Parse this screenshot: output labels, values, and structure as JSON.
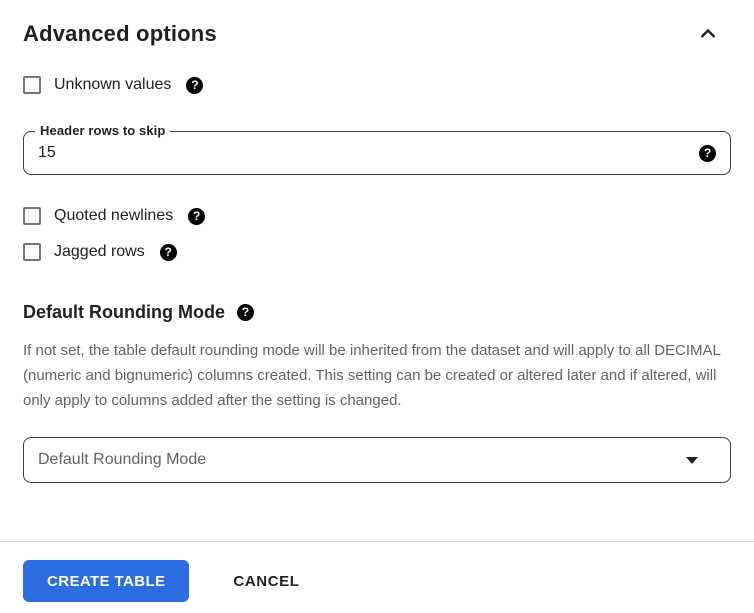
{
  "panel": {
    "title": "Advanced options"
  },
  "fields": {
    "unknown_values": {
      "label": "Unknown values",
      "checked": false
    },
    "header_rows_to_skip": {
      "label": "Header rows to skip",
      "value": "15"
    },
    "quoted_newlines": {
      "label": "Quoted newlines",
      "checked": false
    },
    "jagged_rows": {
      "label": "Jagged rows",
      "checked": false
    }
  },
  "rounding": {
    "title": "Default Rounding Mode",
    "description": "If not set, the table default rounding mode will be inherited from the dataset and will apply to all DECIMAL (numeric and bignumeric) columns created. This setting can be created or altered later and if altered, will only apply to columns added after the setting is changed.",
    "select_placeholder": "Default Rounding Mode"
  },
  "actions": {
    "create_label": "CREATE TABLE",
    "cancel_label": "CANCEL"
  },
  "icons": {
    "help_glyph": "?"
  },
  "colors": {
    "primary_button": "#2b6de0",
    "text": "#202124",
    "secondary_text": "#5f6368",
    "field_border": "#3c4043",
    "checkbox_border": "#757575",
    "divider": "#dadce0",
    "help_icon_bg": "#000000"
  }
}
